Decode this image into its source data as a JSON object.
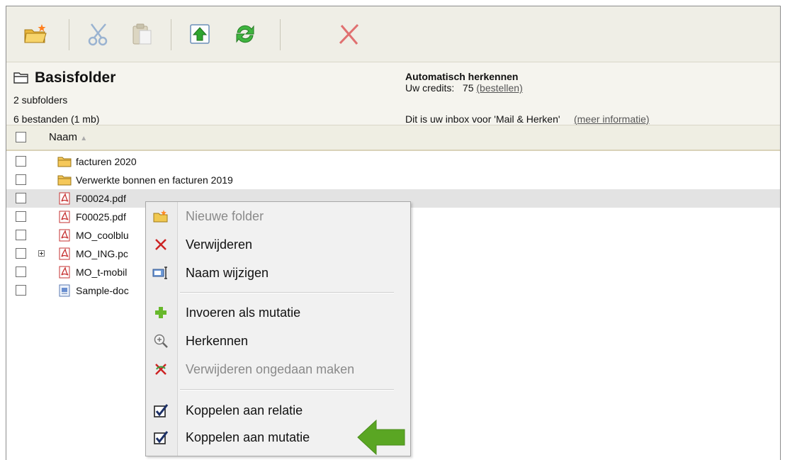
{
  "toolbar": {
    "buttons": [
      {
        "name": "new-folder",
        "icon": "new-folder-icon"
      },
      {
        "name": "cut",
        "icon": "scissors-icon"
      },
      {
        "name": "paste",
        "icon": "clipboard-icon"
      },
      {
        "name": "upload",
        "icon": "upload-arrow-icon"
      },
      {
        "name": "refresh",
        "icon": "refresh-icon"
      },
      {
        "name": "delete",
        "icon": "red-x-icon"
      }
    ]
  },
  "header": {
    "title": "Basisfolder",
    "subfolders": "2 subfolders",
    "files": "6 bestanden (1 mb)",
    "auto_title": "Automatisch herkennen",
    "credits_label": "Uw credits:",
    "credits_value": "75",
    "credits_link": "(bestellen)",
    "inbox_text": "Dit is uw inbox voor 'Mail & Herken'",
    "inbox_link": "(meer informatie)"
  },
  "table": {
    "column_name": "Naam",
    "sort_indicator": "▲",
    "rows": [
      {
        "label": "facturen 2020",
        "type": "folder"
      },
      {
        "label": "Verwerkte bonnen en facturen 2019",
        "type": "folder"
      },
      {
        "label": "F00024.pdf",
        "type": "pdf",
        "selected": true
      },
      {
        "label": "F00025.pdf",
        "type": "pdf"
      },
      {
        "label": "MO_coolblu",
        "type": "pdf"
      },
      {
        "label": "MO_ING.pc",
        "type": "pdf",
        "expander": true
      },
      {
        "label": "MO_t-mobil",
        "type": "pdf"
      },
      {
        "label": "Sample-doc",
        "type": "doc"
      }
    ]
  },
  "context_menu": {
    "items": [
      {
        "label": "Nieuwe folder",
        "icon": "new-folder-icon",
        "disabled": true
      },
      {
        "label": "Verwijderen",
        "icon": "red-x-icon",
        "disabled": false
      },
      {
        "label": "Naam wijzigen",
        "icon": "rename-icon",
        "disabled": false
      },
      {
        "label": "Invoeren als mutatie",
        "icon": "green-plus-icon",
        "disabled": false
      },
      {
        "label": "Herkennen",
        "icon": "zoom-in-icon",
        "disabled": false
      },
      {
        "label": "Verwijderen ongedaan maken",
        "icon": "undo-delete-icon",
        "disabled": true
      },
      {
        "label": "Koppelen aan relatie",
        "icon": "checkbox-checked-icon",
        "disabled": false
      },
      {
        "label": "Koppelen aan mutatie",
        "icon": "checkbox-checked-icon",
        "disabled": false
      }
    ]
  },
  "colors": {
    "accent_green": "#5aa623",
    "delete_red": "#cc2222",
    "toolbar_bg": "#efeee6"
  }
}
